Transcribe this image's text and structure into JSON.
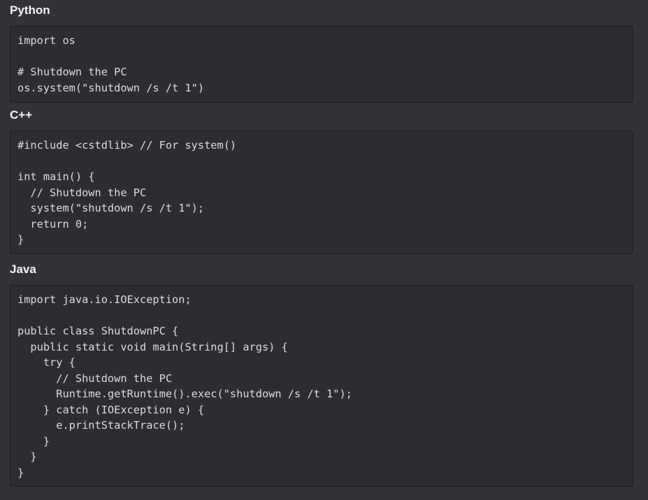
{
  "sections": [
    {
      "heading": "Python",
      "code": "import os\n\n# Shutdown the PC\nos.system(\"shutdown /s /t 1\")"
    },
    {
      "heading": "C++",
      "code": "#include <cstdlib> // For system()\n\nint main() {\n  // Shutdown the PC\n  system(\"shutdown /s /t 1\");\n  return 0;\n}"
    },
    {
      "heading": "Java",
      "code": "import java.io.IOException;\n\npublic class ShutdownPC {\n  public static void main(String[] args) {\n    try {\n      // Shutdown the PC\n      Runtime.getRuntime().exec(\"shutdown /s /t 1\");\n    } catch (IOException e) {\n      e.printStackTrace();\n    }\n  }\n}"
    }
  ],
  "colors": {
    "background": "#313338",
    "code_background": "#2b2d31",
    "code_border": "#1e1f22",
    "heading_text": "#f2f3f5",
    "code_text": "#dbdee1"
  }
}
